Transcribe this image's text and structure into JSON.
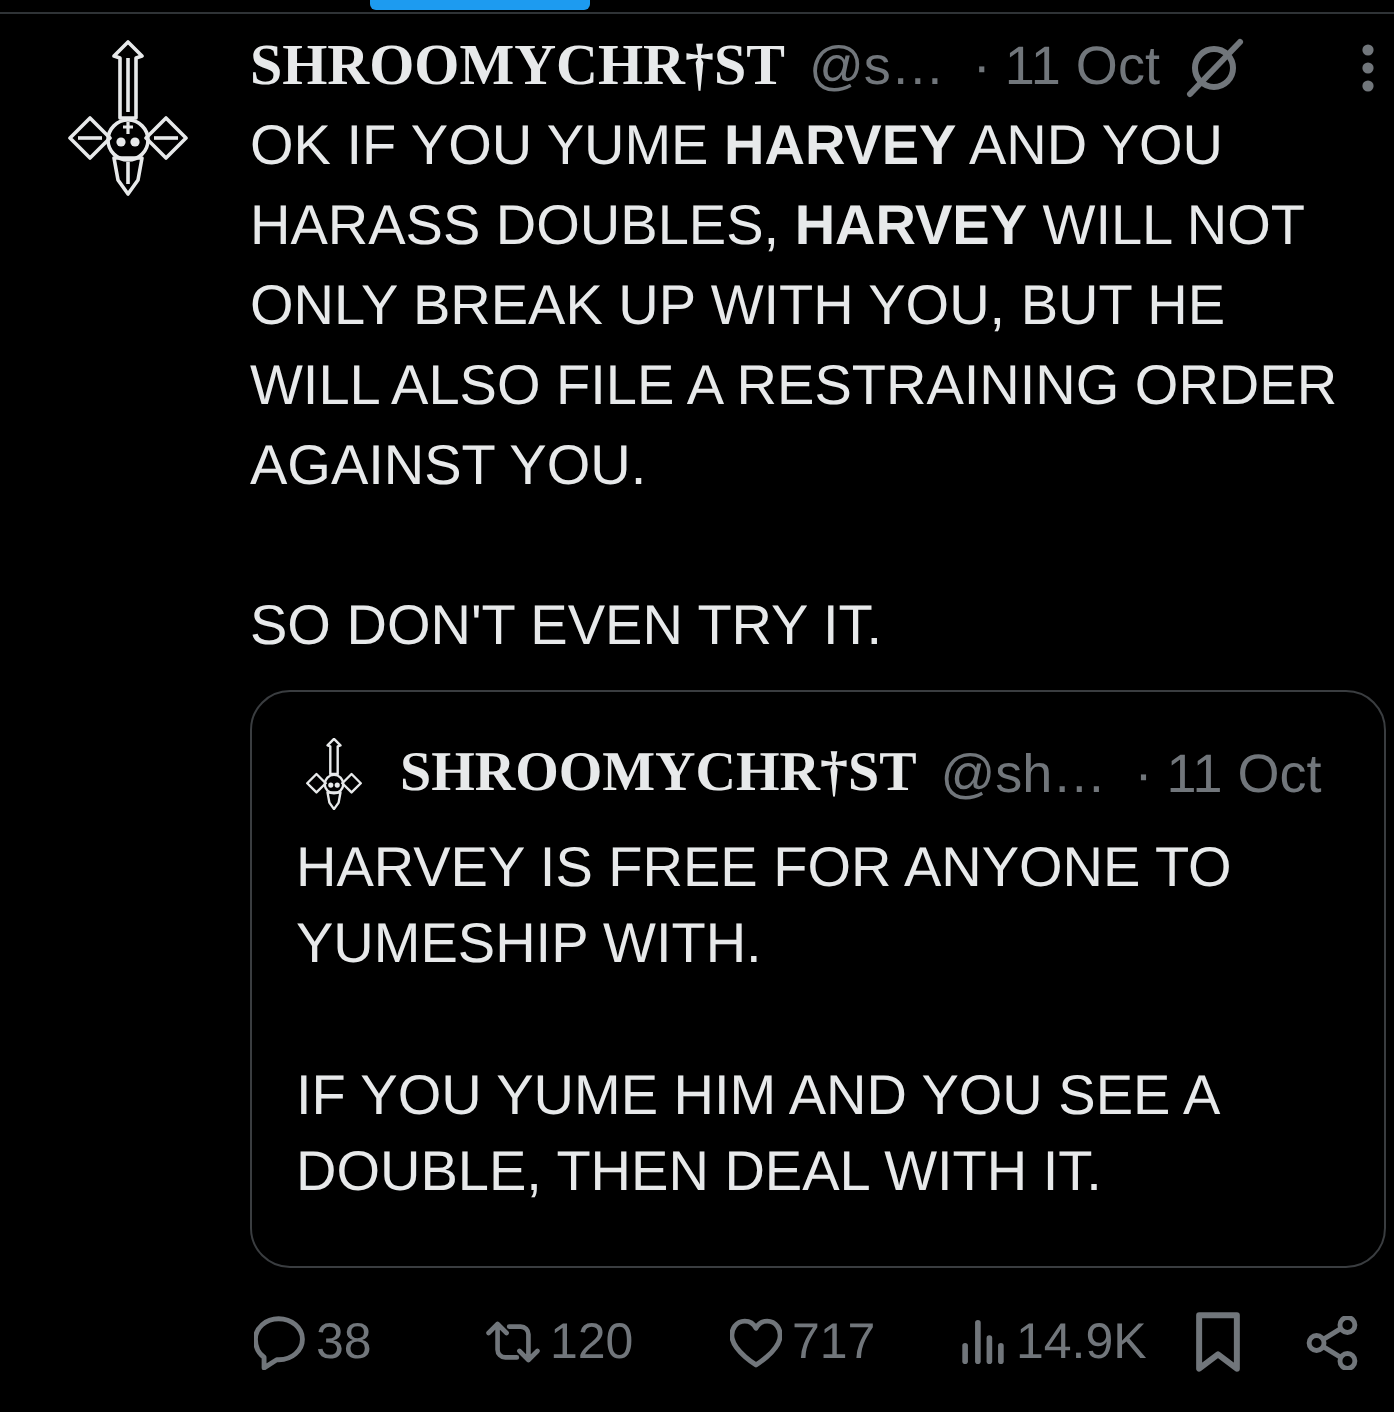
{
  "tweet": {
    "author": {
      "name": "SHROOMYCHR†ST",
      "handle": "@s…",
      "separator": "·",
      "time": "11 Oct"
    },
    "paragraphs": [
      "OK IF YOU YUME **HARVEY** AND YOU HARASS DOUBLES, **HARVEY** WILL NOT ONLY BREAK UP WITH YOU, BUT HE WILL ALSO FILE A RESTRAINING ORDER AGAINST YOU.",
      "SO DON'T EVEN TRY IT."
    ],
    "quote": {
      "author": {
        "name": "SHROOMYCHR†ST",
        "handle": "@sh…",
        "separator": "·",
        "time": "11 Oct"
      },
      "paragraphs": [
        "HARVEY IS FREE FOR ANYONE TO YUMESHIP WITH.",
        "IF YOU YUME HIM AND YOU SEE A DOUBLE, THEN DEAL WITH IT."
      ]
    },
    "actions": [
      {
        "kind": "reply",
        "count": "38"
      },
      {
        "kind": "repost",
        "count": "120"
      },
      {
        "kind": "like",
        "count": "717"
      },
      {
        "kind": "views",
        "count": "14.9K"
      },
      {
        "kind": "bookmark"
      },
      {
        "kind": "share"
      }
    ]
  }
}
